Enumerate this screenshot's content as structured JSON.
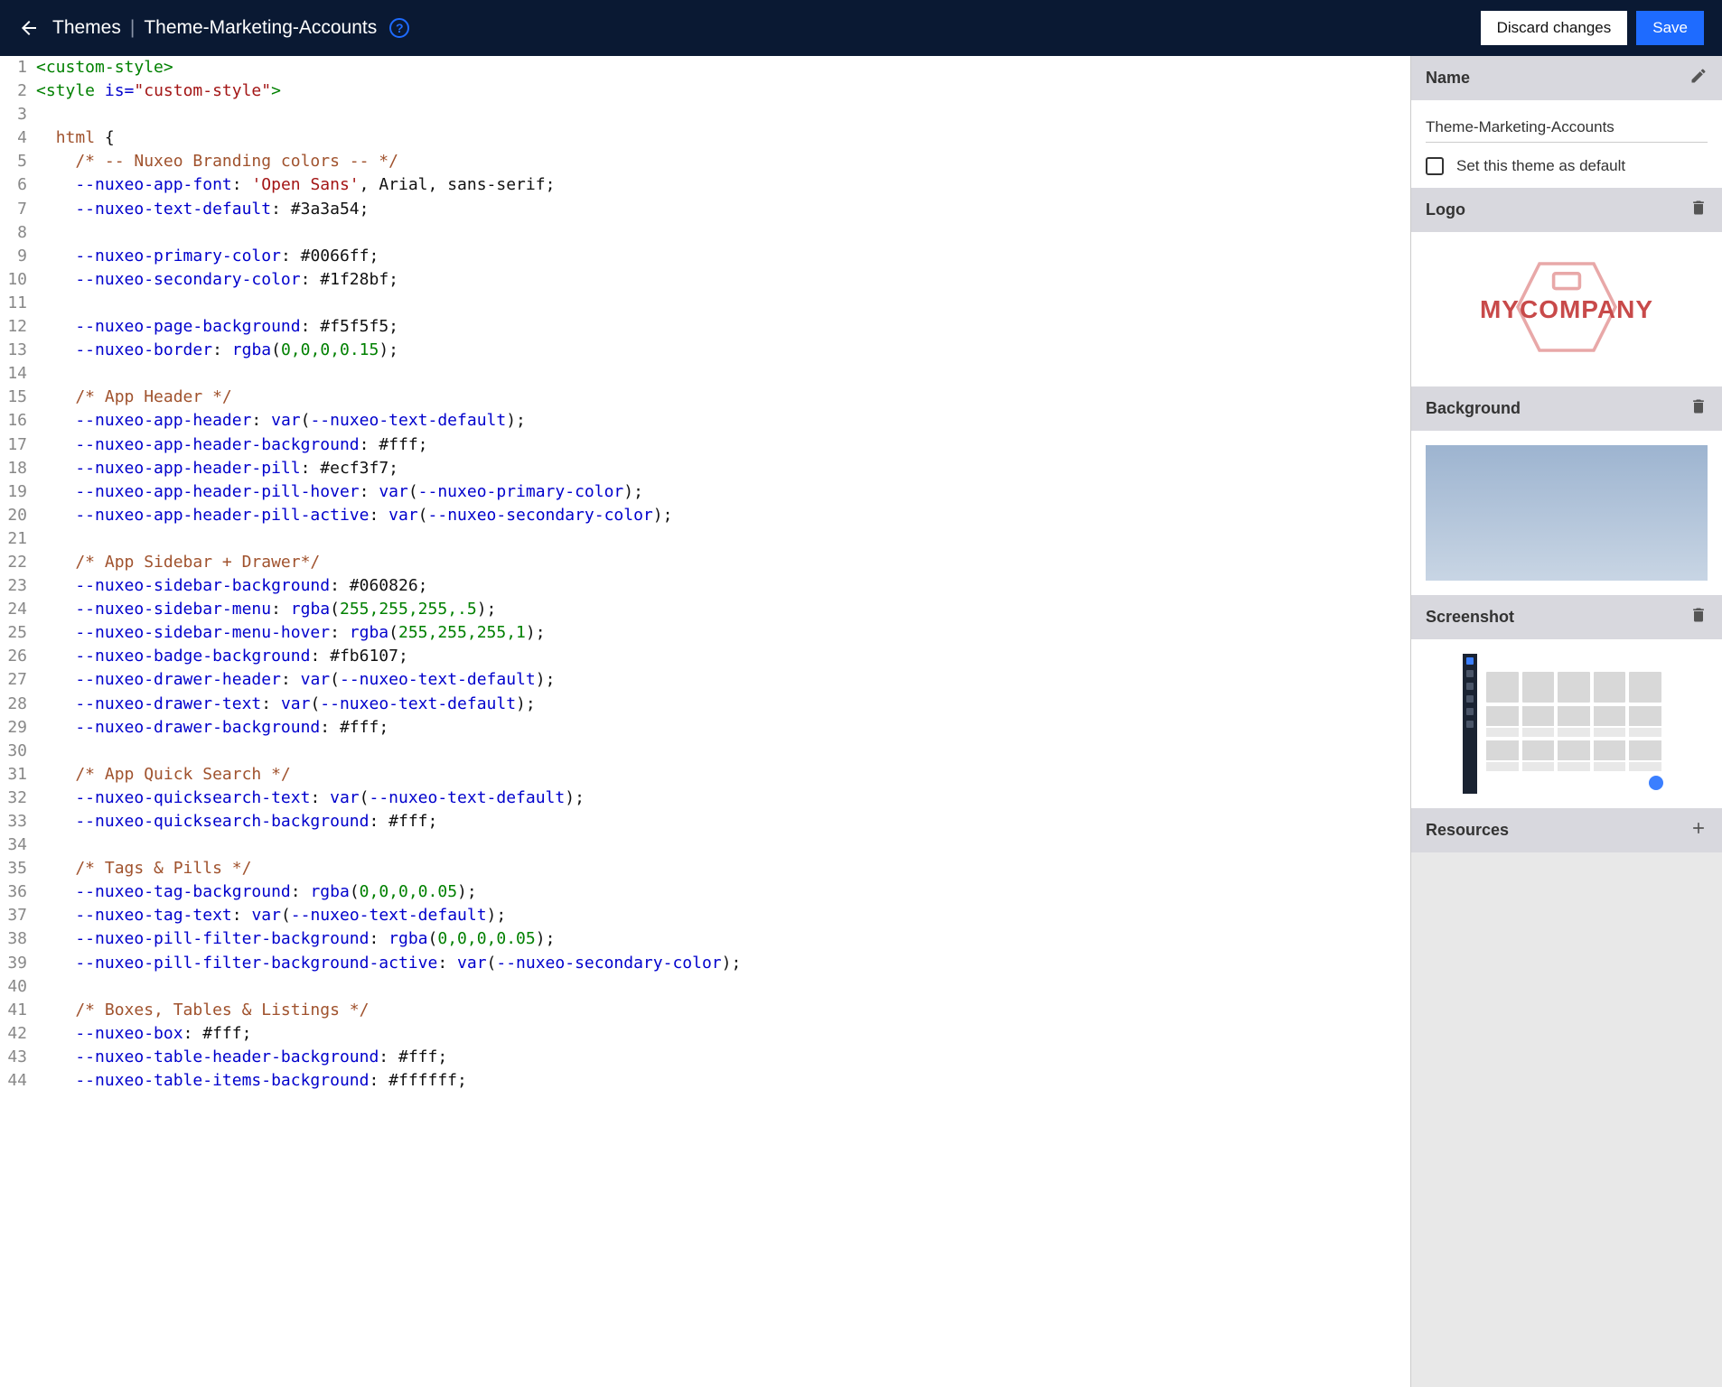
{
  "topbar": {
    "back_label": "Back",
    "breadcrumb_root": "Themes",
    "breadcrumb_current": "Theme-Marketing-Accounts",
    "discard_label": "Discard changes",
    "save_label": "Save"
  },
  "code": {
    "lines": [
      {
        "n": 1,
        "t": "tag",
        "s": "<custom-style>"
      },
      {
        "n": 2,
        "t": "tag2",
        "s": "<style is=\"custom-style\">"
      },
      {
        "n": 3,
        "t": "blank",
        "s": ""
      },
      {
        "n": 4,
        "t": "sel",
        "s": "  html {"
      },
      {
        "n": 5,
        "t": "cmt",
        "s": "    /* -- Nuxeo Branding colors -- */"
      },
      {
        "n": 6,
        "t": "prop",
        "p": "    --nuxeo-app-font",
        "v": "'Open Sans', Arial, sans-serif"
      },
      {
        "n": 7,
        "t": "prop",
        "p": "    --nuxeo-text-default",
        "v": "#3a3a54"
      },
      {
        "n": 8,
        "t": "blank",
        "s": ""
      },
      {
        "n": 9,
        "t": "prop",
        "p": "    --nuxeo-primary-color",
        "v": "#0066ff"
      },
      {
        "n": 10,
        "t": "prop",
        "p": "    --nuxeo-secondary-color",
        "v": "#1f28bf"
      },
      {
        "n": 11,
        "t": "blank",
        "s": ""
      },
      {
        "n": 12,
        "t": "prop",
        "p": "    --nuxeo-page-background",
        "v": "#f5f5f5"
      },
      {
        "n": 13,
        "t": "propfn",
        "p": "    --nuxeo-border",
        "fn": "rgba",
        "args": "0,0,0,0.15"
      },
      {
        "n": 14,
        "t": "blank",
        "s": ""
      },
      {
        "n": 15,
        "t": "cmt",
        "s": "    /* App Header */"
      },
      {
        "n": 16,
        "t": "propvar",
        "p": "    --nuxeo-app-header",
        "var": "--nuxeo-text-default"
      },
      {
        "n": 17,
        "t": "prop",
        "p": "    --nuxeo-app-header-background",
        "v": "#fff"
      },
      {
        "n": 18,
        "t": "prop",
        "p": "    --nuxeo-app-header-pill",
        "v": "#ecf3f7"
      },
      {
        "n": 19,
        "t": "propvar",
        "p": "    --nuxeo-app-header-pill-hover",
        "var": "--nuxeo-primary-color"
      },
      {
        "n": 20,
        "t": "propvar",
        "p": "    --nuxeo-app-header-pill-active",
        "var": "--nuxeo-secondary-color"
      },
      {
        "n": 21,
        "t": "blank",
        "s": ""
      },
      {
        "n": 22,
        "t": "cmt",
        "s": "    /* App Sidebar + Drawer*/"
      },
      {
        "n": 23,
        "t": "prop",
        "p": "    --nuxeo-sidebar-background",
        "v": "#060826"
      },
      {
        "n": 24,
        "t": "propfn",
        "p": "    --nuxeo-sidebar-menu",
        "fn": "rgba",
        "args": "255,255,255,.5"
      },
      {
        "n": 25,
        "t": "propfn",
        "p": "    --nuxeo-sidebar-menu-hover",
        "fn": "rgba",
        "args": "255,255,255,1"
      },
      {
        "n": 26,
        "t": "prop",
        "p": "    --nuxeo-badge-background",
        "v": "#fb6107"
      },
      {
        "n": 27,
        "t": "propvar",
        "p": "    --nuxeo-drawer-header",
        "var": "--nuxeo-text-default"
      },
      {
        "n": 28,
        "t": "propvar",
        "p": "    --nuxeo-drawer-text",
        "var": "--nuxeo-text-default"
      },
      {
        "n": 29,
        "t": "prop",
        "p": "    --nuxeo-drawer-background",
        "v": "#fff"
      },
      {
        "n": 30,
        "t": "blank",
        "s": ""
      },
      {
        "n": 31,
        "t": "cmt",
        "s": "    /* App Quick Search */"
      },
      {
        "n": 32,
        "t": "propvar",
        "p": "    --nuxeo-quicksearch-text",
        "var": "--nuxeo-text-default"
      },
      {
        "n": 33,
        "t": "prop",
        "p": "    --nuxeo-quicksearch-background",
        "v": "#fff"
      },
      {
        "n": 34,
        "t": "blank",
        "s": ""
      },
      {
        "n": 35,
        "t": "cmt",
        "s": "    /* Tags & Pills */"
      },
      {
        "n": 36,
        "t": "propfn",
        "p": "    --nuxeo-tag-background",
        "fn": "rgba",
        "args": "0,0,0,0.05"
      },
      {
        "n": 37,
        "t": "propvar",
        "p": "    --nuxeo-tag-text",
        "var": "--nuxeo-text-default"
      },
      {
        "n": 38,
        "t": "propfn",
        "p": "    --nuxeo-pill-filter-background",
        "fn": "rgba",
        "args": "0,0,0,0.05"
      },
      {
        "n": 39,
        "t": "propvar",
        "p": "    --nuxeo-pill-filter-background-active",
        "var": "--nuxeo-secondary-color"
      },
      {
        "n": 40,
        "t": "blank",
        "s": ""
      },
      {
        "n": 41,
        "t": "cmt",
        "s": "    /* Boxes, Tables & Listings */"
      },
      {
        "n": 42,
        "t": "prop",
        "p": "    --nuxeo-box",
        "v": "#fff"
      },
      {
        "n": 43,
        "t": "prop",
        "p": "    --nuxeo-table-header-background",
        "v": "#fff"
      },
      {
        "n": 44,
        "t": "prop",
        "p": "    --nuxeo-table-items-background",
        "v": "#ffffff"
      }
    ]
  },
  "sidebar": {
    "name_header": "Name",
    "name_value": "Theme-Marketing-Accounts",
    "default_label": "Set this theme as default",
    "logo_header": "Logo",
    "logo_text": "MYCOMPANY",
    "background_header": "Background",
    "screenshot_header": "Screenshot",
    "resources_header": "Resources"
  }
}
